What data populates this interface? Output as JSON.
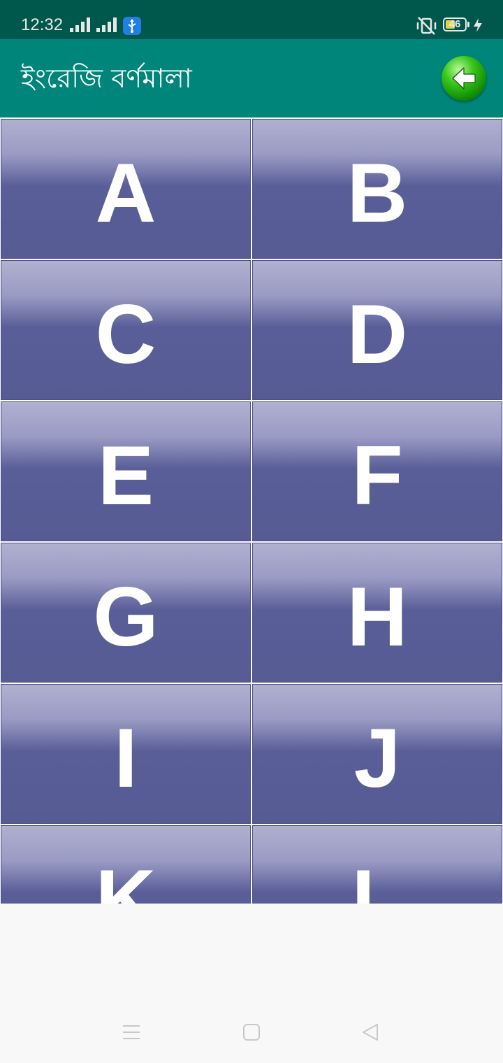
{
  "status_bar": {
    "time": "12:32",
    "battery_level": "46",
    "icons": [
      "signal-icon",
      "signal-icon",
      "usb-icon",
      "vibrate-off-icon",
      "battery-icon",
      "charging-icon"
    ]
  },
  "app_bar": {
    "title": "ইংরেজি বর্ণমালা",
    "back_icon": "green-back-arrow-icon"
  },
  "letters": [
    "A",
    "B",
    "C",
    "D",
    "E",
    "F",
    "G",
    "H",
    "I",
    "J",
    "K",
    "L"
  ],
  "nav_bar": {
    "icons": [
      "menu-icon",
      "home-icon",
      "back-icon"
    ]
  },
  "colors": {
    "status_bar": "#00574b",
    "app_bar": "#00857a",
    "tile_top": "#b0b0d0",
    "tile_bottom": "#575b94",
    "letter": "#ffffff"
  }
}
